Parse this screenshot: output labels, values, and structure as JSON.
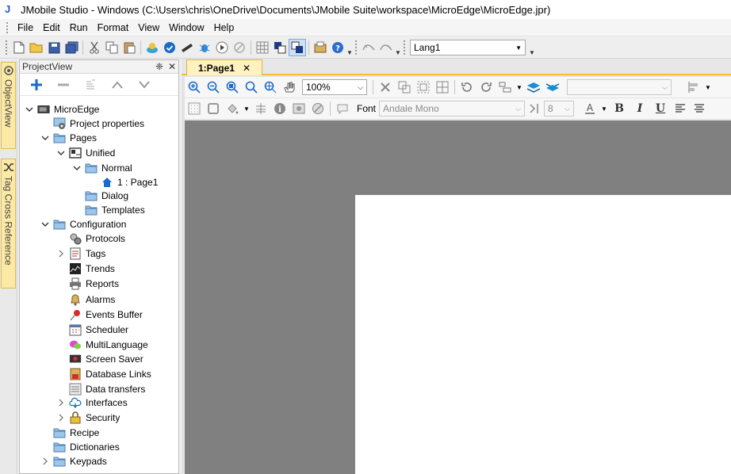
{
  "window": {
    "title": "JMobile Studio - Windows (C:\\Users\\chris\\OneDrive\\Documents\\JMobile Suite\\workspace\\MicroEdge\\MicroEdge.jpr)"
  },
  "menu": [
    "File",
    "Edit",
    "Run",
    "Format",
    "View",
    "Window",
    "Help"
  ],
  "toolbar": {
    "language": "Lang1"
  },
  "side_tabs": [
    "ObjectView",
    "Tag Cross Reference"
  ],
  "panel": {
    "title": "ProjectView",
    "pin_glyph": "❈",
    "close_glyph": "✕"
  },
  "tree": [
    {
      "label": "MicroEdge",
      "level": 0,
      "twisty": "open",
      "icon": "device-icon"
    },
    {
      "label": "Project properties",
      "level": 1,
      "twisty": "none",
      "icon": "properties-icon"
    },
    {
      "label": "Pages",
      "level": 1,
      "twisty": "open",
      "icon": "folder-icon"
    },
    {
      "label": "Unified",
      "level": 2,
      "twisty": "open",
      "icon": "unified-icon"
    },
    {
      "label": "Normal",
      "level": 3,
      "twisty": "open",
      "icon": "folder-icon"
    },
    {
      "label": "1 : Page1",
      "level": 4,
      "twisty": "none",
      "icon": "home-icon"
    },
    {
      "label": "Dialog",
      "level": 3,
      "twisty": "none",
      "icon": "folder-icon"
    },
    {
      "label": "Templates",
      "level": 3,
      "twisty": "none",
      "icon": "folder-icon"
    },
    {
      "label": "Configuration",
      "level": 1,
      "twisty": "open",
      "icon": "folder-icon"
    },
    {
      "label": "Protocols",
      "level": 2,
      "twisty": "none",
      "icon": "protocols-icon"
    },
    {
      "label": "Tags",
      "level": 2,
      "twisty": "closed",
      "icon": "tags-icon"
    },
    {
      "label": "Trends",
      "level": 2,
      "twisty": "none",
      "icon": "trends-icon"
    },
    {
      "label": "Reports",
      "level": 2,
      "twisty": "none",
      "icon": "printer-icon"
    },
    {
      "label": "Alarms",
      "level": 2,
      "twisty": "none",
      "icon": "bell-icon"
    },
    {
      "label": "Events Buffer",
      "level": 2,
      "twisty": "none",
      "icon": "pin-icon"
    },
    {
      "label": "Scheduler",
      "level": 2,
      "twisty": "none",
      "icon": "calendar-icon"
    },
    {
      "label": "MultiLanguage",
      "level": 2,
      "twisty": "none",
      "icon": "speech-bubble-icon"
    },
    {
      "label": "Screen Saver",
      "level": 2,
      "twisty": "none",
      "icon": "screen-saver-icon"
    },
    {
      "label": "Database Links",
      "level": 2,
      "twisty": "none",
      "icon": "database-icon"
    },
    {
      "label": "Data transfers",
      "level": 2,
      "twisty": "none",
      "icon": "data-transfer-icon"
    },
    {
      "label": "Interfaces",
      "level": 2,
      "twisty": "closed",
      "icon": "cloud-icon"
    },
    {
      "label": "Security",
      "level": 2,
      "twisty": "closed",
      "icon": "lock-icon"
    },
    {
      "label": "Recipe",
      "level": 1,
      "twisty": "none",
      "icon": "folder-icon"
    },
    {
      "label": "Dictionaries",
      "level": 1,
      "twisty": "none",
      "icon": "folder-icon"
    },
    {
      "label": "Keypads",
      "level": 1,
      "twisty": "closed",
      "icon": "folder-icon"
    }
  ],
  "editor": {
    "tab_label": "1:Page1",
    "zoom": "100%",
    "font_label": "Font",
    "font_name": "Andale Mono",
    "font_size": "8",
    "tab_close_glyph": "✕"
  },
  "colors": {
    "accent_tab": "#f5c030",
    "canvas": "#808080",
    "page": "#ffffff",
    "icon_blue": "#1b6ac9"
  }
}
